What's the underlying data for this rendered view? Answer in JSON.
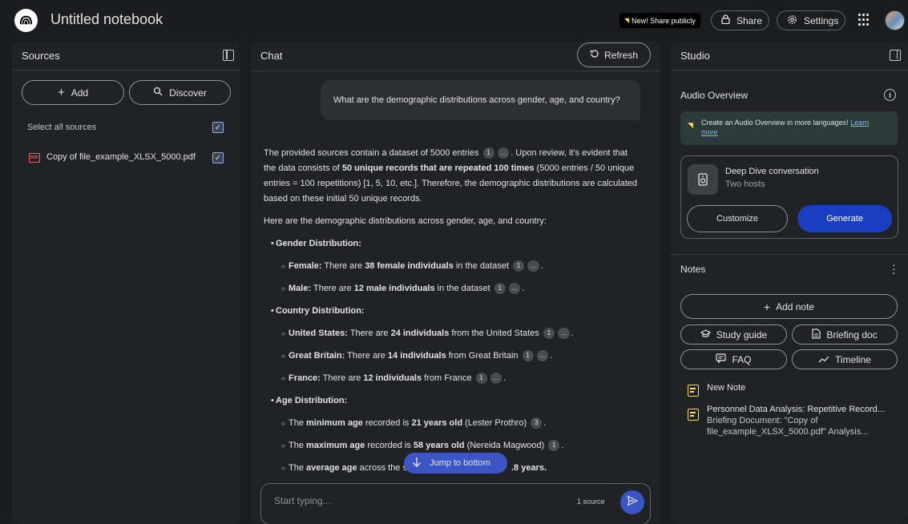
{
  "app": {
    "title": "Untitled notebook",
    "share_public": "New! Share publicly",
    "share": "Share",
    "settings": "Settings"
  },
  "sources": {
    "title": "Sources",
    "add": "Add",
    "discover": "Discover",
    "select_all": "Select all sources",
    "items": [
      {
        "name": "Copy of file_example_XLSX_5000.pdf",
        "checked": true,
        "icon": "pdf-icon"
      }
    ]
  },
  "chat": {
    "title": "Chat",
    "refresh": "Refresh",
    "question": "What are the demographic distributions across gender, age, and country?",
    "jump": "Jump to bottom",
    "input_placeholder": "Start typing...",
    "source_count": "1 source"
  },
  "answer": {
    "p1a": "The provided sources contain a dataset of 5000 entries",
    "p1b": ". Upon review, it's evident that the data consists of ",
    "p1c": "50 unique records that are repeated 100 times",
    "p1d": " (5000 entries / 50 unique entries = 100 repetitions) [1, 5, 10, etc.]. Therefore, the demographic distributions are calculated based on these initial 50 unique records.",
    "p2": "Here are the demographic distributions across gender, age, and country:",
    "gender_h": "Gender Distribution:",
    "female_l": "Female:",
    "female_t1": " There are ",
    "female_b": "38 female individuals",
    "female_t2": " in the dataset",
    "male_l": "Male:",
    "male_t1": " There are ",
    "male_b": "12 male individuals",
    "male_t2": " in the dataset",
    "country_h": "Country Distribution:",
    "us_l": "United States:",
    "us_t1": " There are ",
    "us_b": "24 individuals",
    "us_t2": " from the United States",
    "gb_l": "Great Britain:",
    "gb_t1": " There are ",
    "gb_b": "14 individuals",
    "gb_t2": " from Great Britain",
    "fr_l": "France:",
    "fr_t1": " There are ",
    "fr_b": "12 individuals",
    "fr_t2": " from France",
    "age_h": "Age Distribution:",
    "min_t1": "The ",
    "min_b1": "minimum age",
    "min_t2": " recorded is ",
    "min_b2": "21 years old",
    "min_t3": " (Lester Prothro)",
    "max_t1": "The ",
    "max_b1": "maximum age",
    "max_t2": " recorded is ",
    "max_b2": "58 years old",
    "max_t3": " (Nereida Magwood)",
    "avg_t1": "The ",
    "avg_b1": "average age",
    "avg_t2": " across the s",
    "avg_b2": ".8 years.",
    "cite_1": "1",
    "cite_3": "3",
    "cite_more": "..."
  },
  "studio": {
    "title": "Studio",
    "audio_title": "Audio Overview",
    "banner_text": "Create an Audio Overview in more languages! ",
    "banner_link_1": "Learn",
    "banner_link_2": "more",
    "dd_title": "Deep Dive conversation",
    "dd_sub": "Two hosts",
    "customize": "Customize",
    "generate": "Generate",
    "notes_title": "Notes",
    "add_note": "Add note",
    "study_guide": "Study guide",
    "briefing_doc": "Briefing doc",
    "faq": "FAQ",
    "timeline": "Timeline",
    "notes": [
      {
        "title": "New Note",
        "body": ""
      },
      {
        "title": "Personnel Data Analysis: Repetitive Record...",
        "body_1": "Briefing Document: \"Copy of",
        "body_2": "file_example_XLSX_5000.pdf\" Analysis..."
      }
    ]
  },
  "colors": {
    "background": "#1b1c1e",
    "panel": "#212225",
    "accent_blue": "#1a3ec0",
    "note_yellow": "#fdd663",
    "pdf_red": "#ee675c"
  }
}
